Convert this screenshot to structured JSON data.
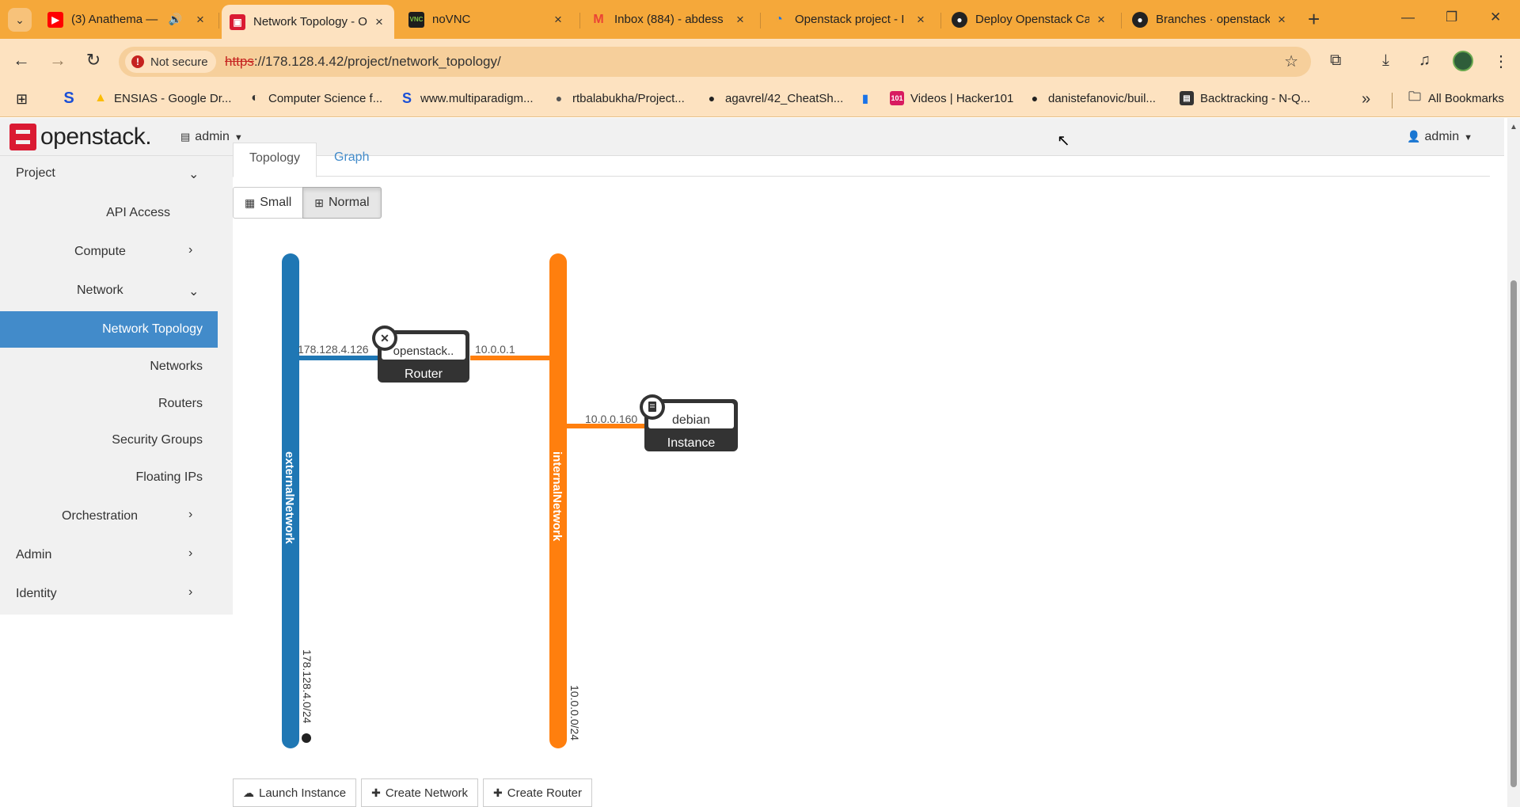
{
  "browser": {
    "tabs": [
      {
        "title": "(3) Anathema —",
        "favicon": "youtube-icon",
        "audio": true
      },
      {
        "title": "Network Topology - O",
        "favicon": "openstack-icon",
        "active": true
      },
      {
        "title": "noVNC",
        "favicon": "novnc-icon"
      },
      {
        "title": "Inbox (884) - abdess",
        "favicon": "gmail-icon"
      },
      {
        "title": "Openstack project - I",
        "favicon": "drive-icon"
      },
      {
        "title": "Deploy Openstack Ca",
        "favicon": "github-icon"
      },
      {
        "title": "Branches · openstack",
        "favicon": "github-icon"
      }
    ],
    "security_label": "Not secure",
    "url_scheme": "https",
    "url_rest": "://178.128.4.42/project/network_topology/",
    "bookmarks": [
      {
        "label": "ENSIAS - Google Dr...",
        "icon": "drive-icon"
      },
      {
        "label": "Computer Science f...",
        "icon": "globe-icon"
      },
      {
        "label": "www.multiparadigm...",
        "icon": "s-logo-icon"
      },
      {
        "label": "rtbalabukha/Project...",
        "icon": "github-icon"
      },
      {
        "label": "agavrel/42_CheatSh...",
        "icon": "github-icon"
      },
      {
        "label": "",
        "icon": "chart-icon"
      },
      {
        "label": "Videos | Hacker101",
        "icon": "hacker101-icon"
      },
      {
        "label": "danistefanovic/buil...",
        "icon": "github-icon"
      },
      {
        "label": "Backtracking - N-Q...",
        "icon": "page-icon"
      }
    ],
    "all_bookmarks_label": "All Bookmarks"
  },
  "app": {
    "logo_text": "openstack.",
    "project_switch": "admin",
    "user_menu": "admin"
  },
  "sidebar": {
    "items": [
      {
        "label": "Project",
        "level": 0,
        "chevron": "down"
      },
      {
        "label": "API Access",
        "level": 2
      },
      {
        "label": "Compute",
        "level": 1,
        "chevron": "right"
      },
      {
        "label": "Network",
        "level": 1,
        "chevron": "down"
      },
      {
        "label": "Network Topology",
        "level": 2,
        "active": true
      },
      {
        "label": "Networks",
        "level": 2
      },
      {
        "label": "Routers",
        "level": 2
      },
      {
        "label": "Security Groups",
        "level": 2
      },
      {
        "label": "Floating IPs",
        "level": 2
      },
      {
        "label": "Orchestration",
        "level": 1,
        "chevron": "right"
      },
      {
        "label": "Admin",
        "level": 0,
        "chevron": "right"
      },
      {
        "label": "Identity",
        "level": 0,
        "chevron": "right"
      }
    ]
  },
  "content": {
    "tabs": [
      "Topology",
      "Graph"
    ],
    "view_buttons": [
      "Small",
      "Normal"
    ],
    "active_view": "Normal",
    "topology": {
      "networks": [
        {
          "name": "externalNetwork",
          "cidr": "178.128.4.0/24",
          "color": "#1f77b4",
          "external": true
        },
        {
          "name": "internalNetwork",
          "cidr": "10.0.0.0/24",
          "color": "#ff7f0e"
        }
      ],
      "router": {
        "name": "openstack..",
        "type": "Router",
        "ip_external": "178.128.4.126",
        "ip_internal": "10.0.0.1"
      },
      "instance": {
        "name": "debian",
        "type": "Instance",
        "ip": "10.0.0.160"
      }
    },
    "actions": [
      "Launch Instance",
      "Create Network",
      "Create Router"
    ]
  },
  "colors": {
    "accent": "#428bca",
    "tabbar": "#f5a83a",
    "toolbar": "#fde2c0"
  }
}
